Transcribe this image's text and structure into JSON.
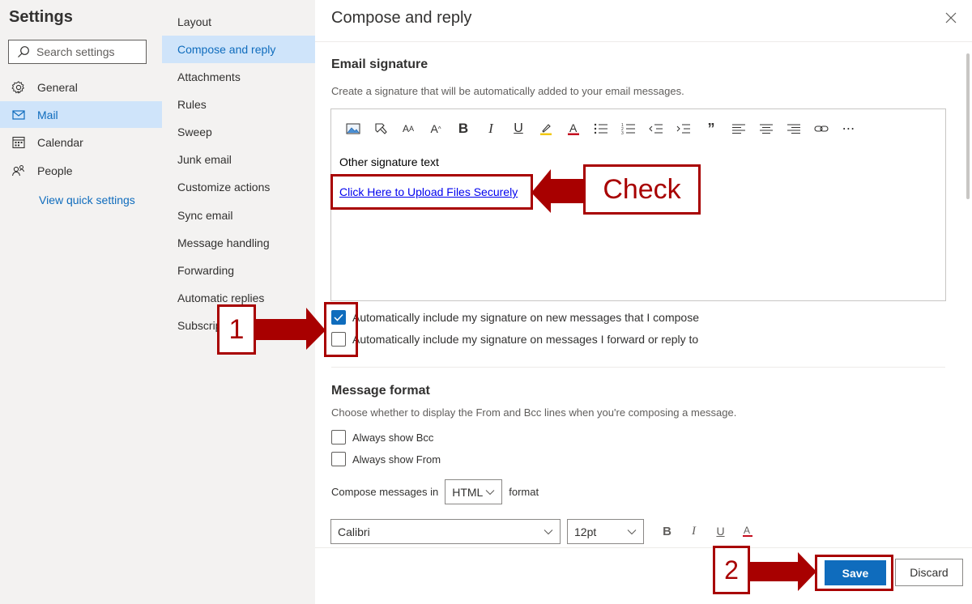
{
  "sidebar": {
    "title": "Settings",
    "search_placeholder": "Search settings",
    "items": [
      {
        "label": "General",
        "icon": "gear-icon"
      },
      {
        "label": "Mail",
        "icon": "mail-icon"
      },
      {
        "label": "Calendar",
        "icon": "calendar-icon"
      },
      {
        "label": "People",
        "icon": "people-icon"
      }
    ],
    "active": "Mail",
    "quick_settings": "View quick settings"
  },
  "subnav": {
    "items": [
      "Layout",
      "Compose and reply",
      "Attachments",
      "Rules",
      "Sweep",
      "Junk email",
      "Customize actions",
      "Sync email",
      "Message handling",
      "Forwarding",
      "Automatic replies",
      "Subscriptions"
    ],
    "active": "Compose and reply",
    "visible_subscriptions": "Subscrip"
  },
  "panel": {
    "title": "Compose and reply",
    "signature": {
      "heading": "Email signature",
      "description": "Create a signature that will be automatically added to your email messages.",
      "text": "Other signature text",
      "link": "Click Here to Upload Files Securely",
      "toolbar_icons": [
        "image-icon",
        "format-painter-icon",
        "font-size-icon",
        "grow-font-icon",
        "bold-icon",
        "italic-icon",
        "underline-icon",
        "highlight-icon",
        "font-color-icon",
        "bullets-icon",
        "numbering-icon",
        "decrease-indent-icon",
        "increase-indent-icon",
        "quote-icon",
        "align-left-icon",
        "align-center-icon",
        "align-right-icon",
        "link-icon",
        "more-icon"
      ],
      "include_new": {
        "label": "Automatically include my signature on new messages that I compose",
        "checked": true
      },
      "include_reply": {
        "label": "Automatically include my signature on messages I forward or reply to",
        "checked": false
      }
    },
    "format": {
      "heading": "Message format",
      "description": "Choose whether to display the From and Bcc lines when you're composing a message.",
      "show_bcc": {
        "label": "Always show Bcc",
        "checked": false
      },
      "show_from": {
        "label": "Always show From",
        "checked": false
      },
      "compose_prefix": "Compose messages in",
      "compose_value": "HTML",
      "compose_suffix": "format",
      "font": "Calibri",
      "size": "12pt"
    },
    "save": "Save",
    "discard": "Discard"
  },
  "annotations": {
    "check": "Check",
    "step1": "1",
    "step2": "2",
    "color": "#a80000"
  }
}
